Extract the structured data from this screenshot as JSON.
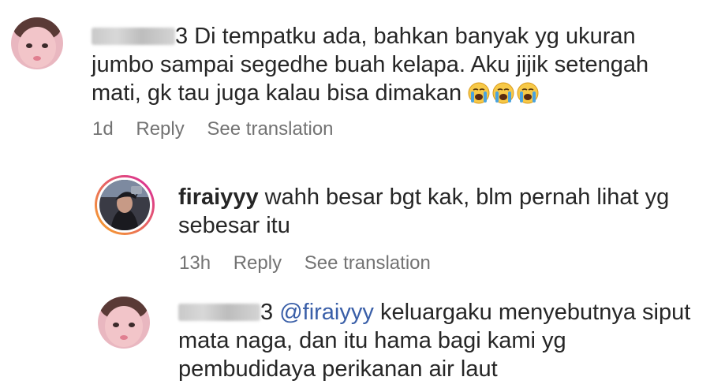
{
  "comments": [
    {
      "username_tail": "3",
      "text": "Di tempatku ada, bahkan banyak yg ukuran jumbo sampai segedhe buah kelapa. Aku jijik setengah mati, gk tau juga kalau bisa dimakan",
      "emojis": [
        "loudly-crying-face",
        "loudly-crying-face",
        "loudly-crying-face"
      ],
      "time": "1d",
      "reply_label": "Reply",
      "translate_label": "See translation"
    },
    {
      "username": "firaiyyy",
      "text": "wahh besar bgt kak, blm pernah lihat yg sebesar itu",
      "time": "13h",
      "reply_label": "Reply",
      "translate_label": "See translation"
    },
    {
      "username_tail": "3",
      "mention": "@firaiyyy",
      "text": "keluargaku menyebutnya siput mata naga, dan itu hama bagi kami yg pembudidaya perikanan air laut"
    }
  ],
  "colors": {
    "text": "#262626",
    "meta": "#737373",
    "mention": "#3a5fa8",
    "story_ring_start": "#f9a825",
    "story_ring_end": "#d6249f"
  }
}
